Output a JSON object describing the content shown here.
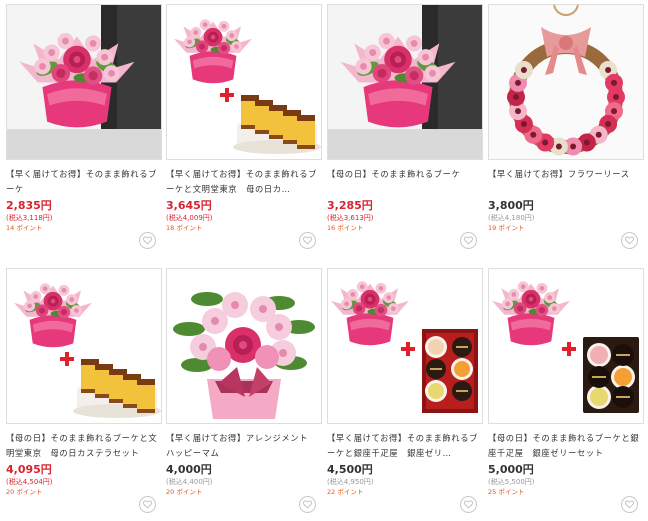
{
  "products": [
    {
      "title": "【早く届けてお得】そのまま飾れるブーケ",
      "price": "2,835円",
      "tax": "(税込3,118円)",
      "points": "14 ポイント",
      "image": "bouquet-pink-roses-alstroemeria",
      "sale": true
    },
    {
      "title": "【早く届けてお得】そのまま飾れるブーケと文明堂東京　母の日カ…",
      "price": "3,645円",
      "tax": "(税込4,009円)",
      "points": "18 ポイント",
      "image": "bouquet-plus-castella",
      "sale": true
    },
    {
      "title": "【母の日】そのまま飾れるブーケ",
      "price": "3,285円",
      "tax": "(税込3,613円)",
      "points": "16 ポイント",
      "image": "bouquet-pink-roses-alstroemeria",
      "sale": true
    },
    {
      "title": "【早く届けてお得】フラワーリース",
      "price": "3,800円",
      "tax": "(税込4,180円)",
      "points": "19 ポイント",
      "image": "flower-wreath",
      "sale": false
    },
    {
      "title": "【母の日】そのまま飾れるブーケと文明堂東京　母の日カステラセット",
      "price": "4,095円",
      "tax": "(税込4,504円)",
      "points": "20 ポイント",
      "image": "bouquet-plus-castella",
      "sale": true
    },
    {
      "title": "【早く届けてお得】アレンジメント　ハッピーマム",
      "price": "4,000円",
      "tax": "(税込4,400円)",
      "points": "20 ポイント",
      "image": "arrangement-happy-mum",
      "sale": false
    },
    {
      "title": "【早く届けてお得】そのまま飾れるブーケと銀座千疋屋　銀座ゼリ…",
      "price": "4,500円",
      "tax": "(税込4,950円)",
      "points": "22 ポイント",
      "image": "bouquet-plus-jelly-box",
      "sale": false
    },
    {
      "title": "【母の日】そのまま飾れるブーケと銀座千疋屋　銀座ゼリーセット",
      "price": "5,000円",
      "tax": "(税込5,500円)",
      "points": "25 ポイント",
      "image": "bouquet-plus-jelly-cups",
      "sale": false
    }
  ],
  "jelly_brand": "GINZA SENBIKIYA",
  "colors": {
    "sale_price": "#d9232f",
    "regular_price": "#333333",
    "points": "#e4571a",
    "border": "#dedede",
    "heart": "#c0c0c0"
  }
}
